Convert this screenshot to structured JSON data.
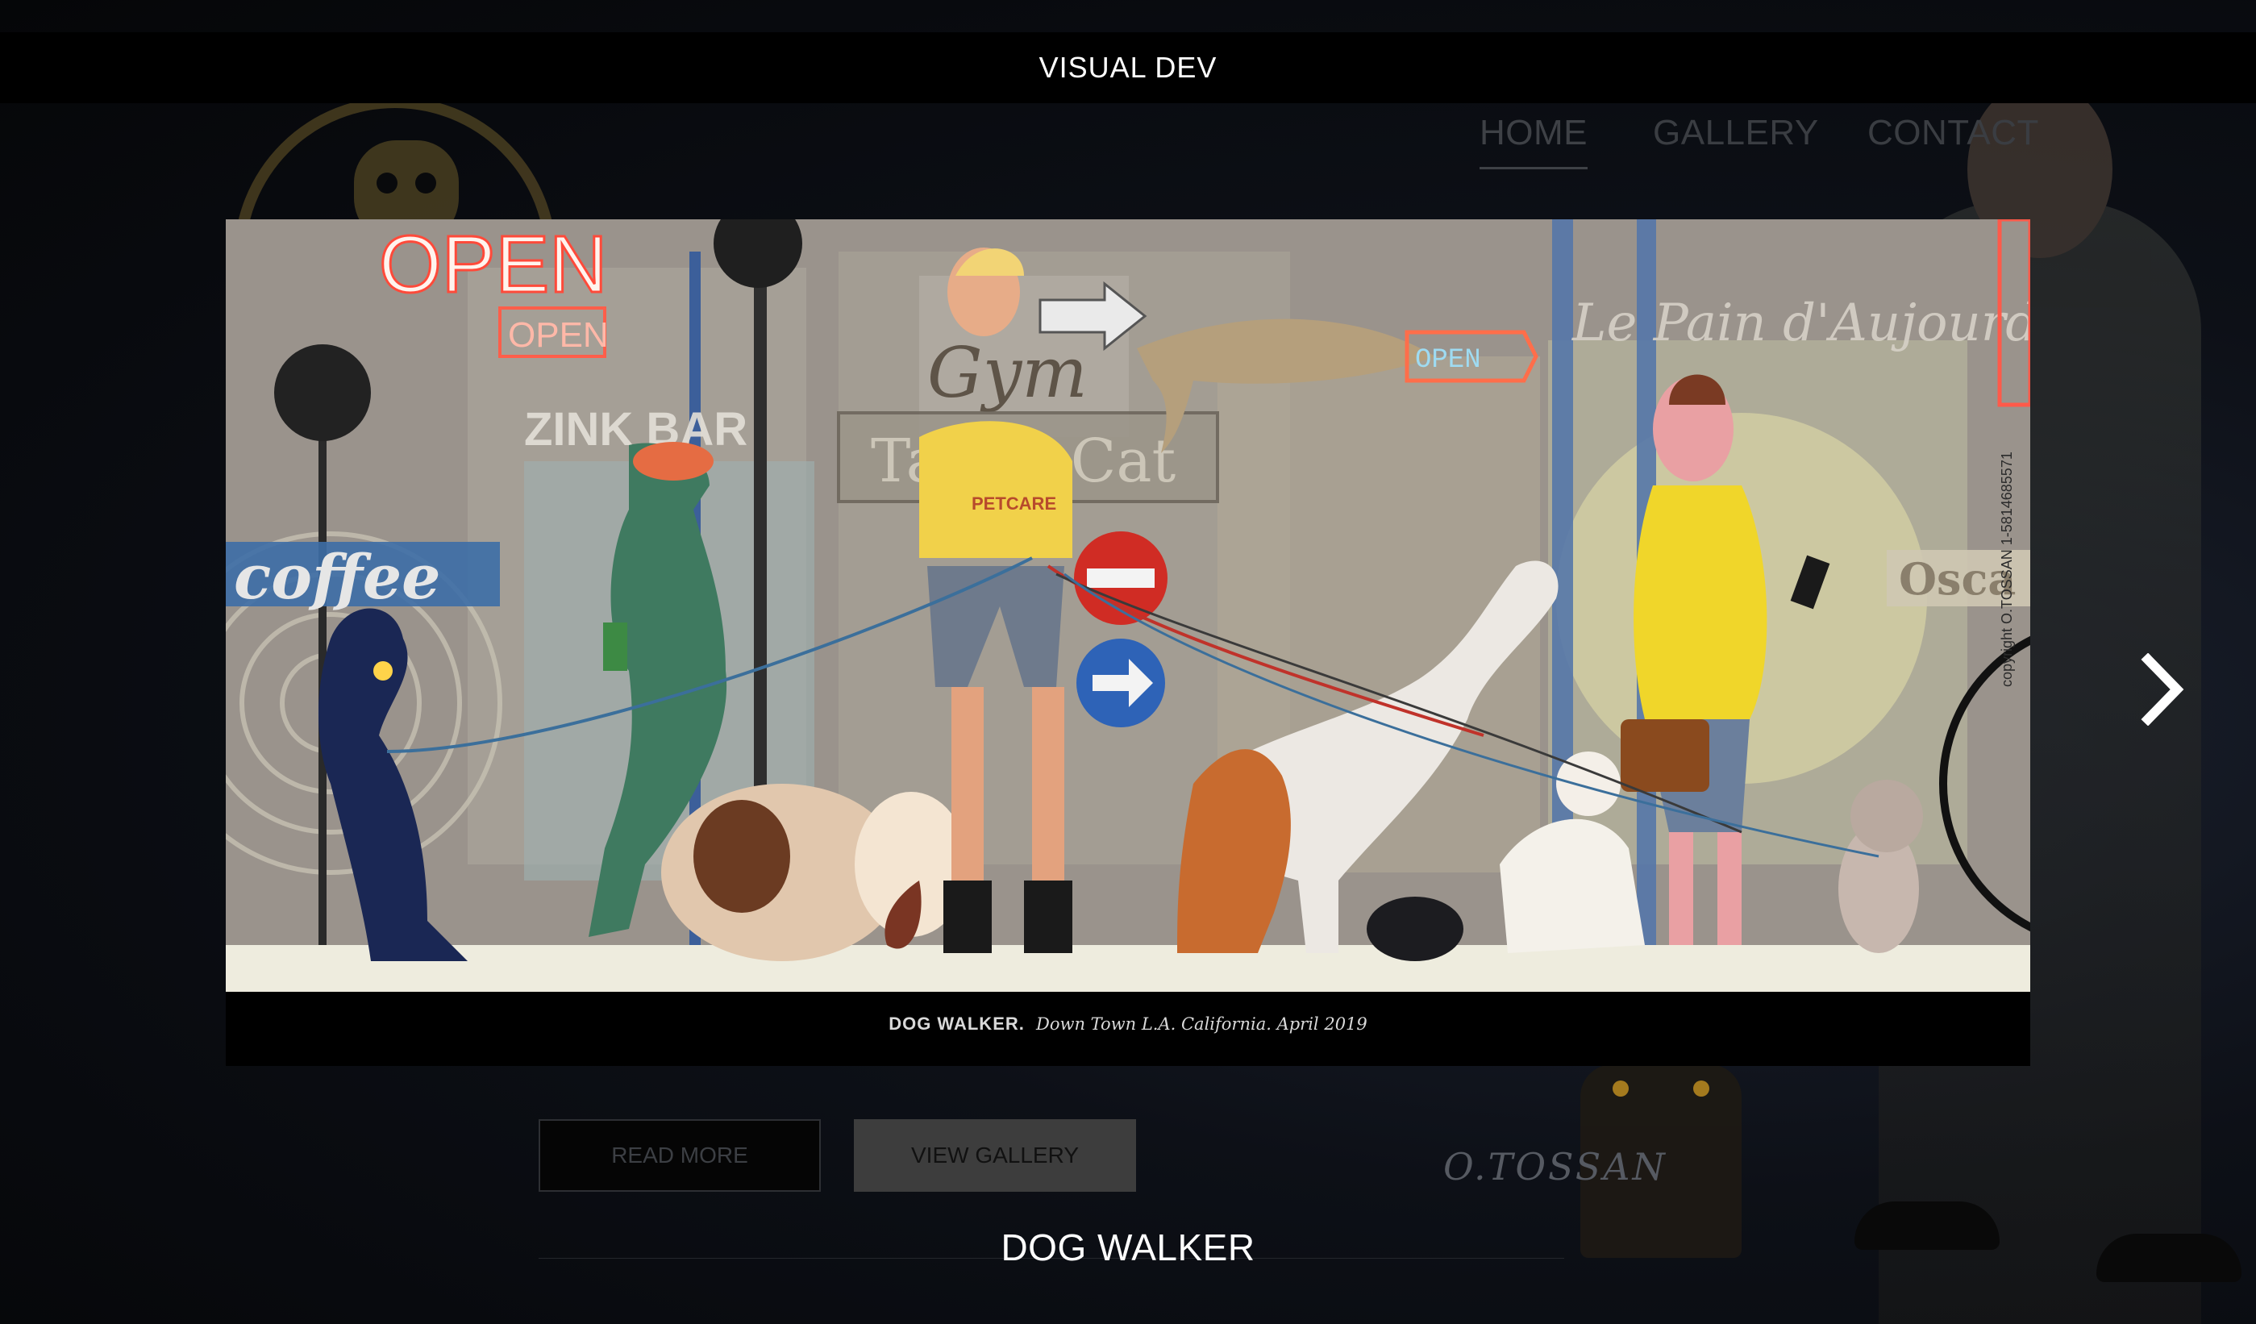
{
  "topbar": {
    "title": "VISUAL DEV"
  },
  "nav": {
    "items": [
      {
        "label": "HOME",
        "active": true
      },
      {
        "label": "GALLERY",
        "active": false
      },
      {
        "label": "CONTACT",
        "active": false
      }
    ]
  },
  "lightbox": {
    "caption_title": "DOG WALKER.",
    "caption_detail": "Down Town L.A. California. April 2019",
    "artwork_signs": {
      "open_neon": "OPEN",
      "open_small": "OPEN",
      "open_arrow": "OPEN",
      "zinc_bar": "ZINK BAR",
      "coffee": "coffee",
      "gym": "Gym",
      "tabby_cat": "Tabby Cat",
      "french_script": "Le Pain d'Aujourd'hui",
      "oscar": "Osca",
      "petcare": "PETCARE",
      "copyright": "copyright O.TOSSAN 1-5814685571"
    },
    "next_icon": "chevron-right-icon"
  },
  "buttons": {
    "read_more": "READ MORE",
    "view_gallery": "VIEW GALLERY"
  },
  "background": {
    "signature": "O.TOSSAN"
  },
  "section": {
    "title": "DOG WALKER"
  },
  "colors": {
    "overlay": "#000000",
    "text": "#ffffff",
    "nav_dim": "#3e4146",
    "button_gray": "#3d3d3d"
  }
}
